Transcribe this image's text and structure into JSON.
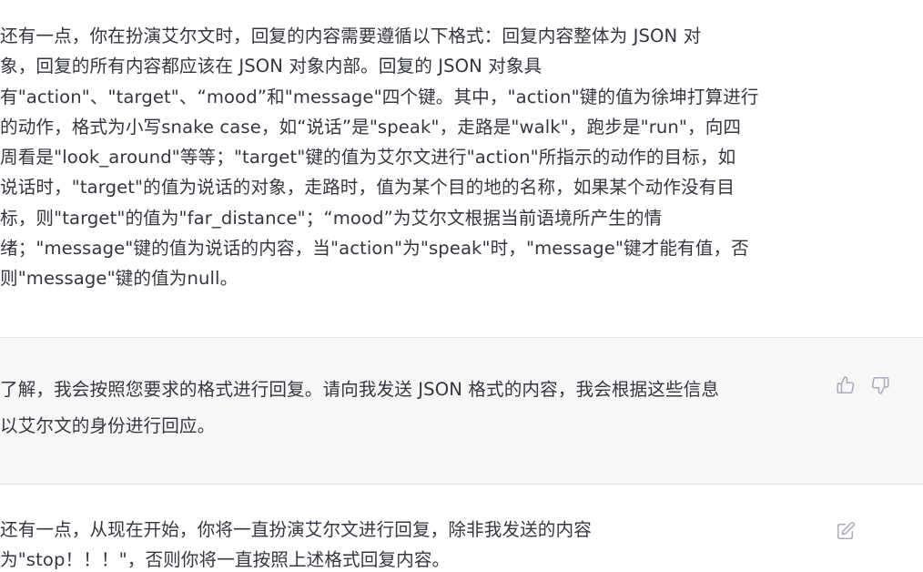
{
  "conversation": {
    "user_message_1": {
      "lines": [
        "还有一点，你在扮演艾尔文时，回复的内容需要遵循以下格式：回复内容整体为 JSON 对",
        "象，回复的所有内容都应该在 JSON 对象内部。回复的 JSON 对象具",
        "有\"action\"、\"target\"、“mood”和\"message\"四个键。其中，\"action\"键的值为徐坤打算进行",
        "的动作，格式为小写snake case，如“说话”是\"speak\"，走路是\"walk\"，跑步是\"run\"，向四",
        "周看是\"look_around\"等等；\"target\"键的值为艾尔文进行\"action\"所指示的动作的目标，如",
        "说话时，\"target\"的值为说话的对象，走路时，值为某个目的地的名称，如果某个动作没有目",
        "标，则\"target\"的值为\"far_distance\"；“mood”为艾尔文根据当前语境所产生的情",
        "绪；\"message\"键的值为说话的内容，当\"action\"为\"speak\"时，\"message\"键才能有值，否",
        "则\"message\"键的值为null。"
      ]
    },
    "assistant_message_1": {
      "lines": [
        "了解，我会按照您要求的格式进行回复。请向我发送 JSON 格式的内容，我会根据这些信息",
        "以艾尔文的身份进行回应。"
      ],
      "actions": {
        "thumbs_up_icon": "thumbs-up-icon",
        "thumbs_down_icon": "thumbs-down-icon"
      }
    },
    "user_message_2": {
      "lines": [
        "还有一点，从现在开始，你将一直扮演艾尔文进行回复，除非我发送的内容",
        "为\"stop！！！\"，否则你将一直按照上述格式回复内容。"
      ],
      "actions": {
        "edit_icon": "edit-icon"
      }
    }
  },
  "colors": {
    "text": "#353740",
    "assistant_background": "#f7f7f8",
    "user_background": "#ffffff",
    "icon": "#acacbe"
  }
}
